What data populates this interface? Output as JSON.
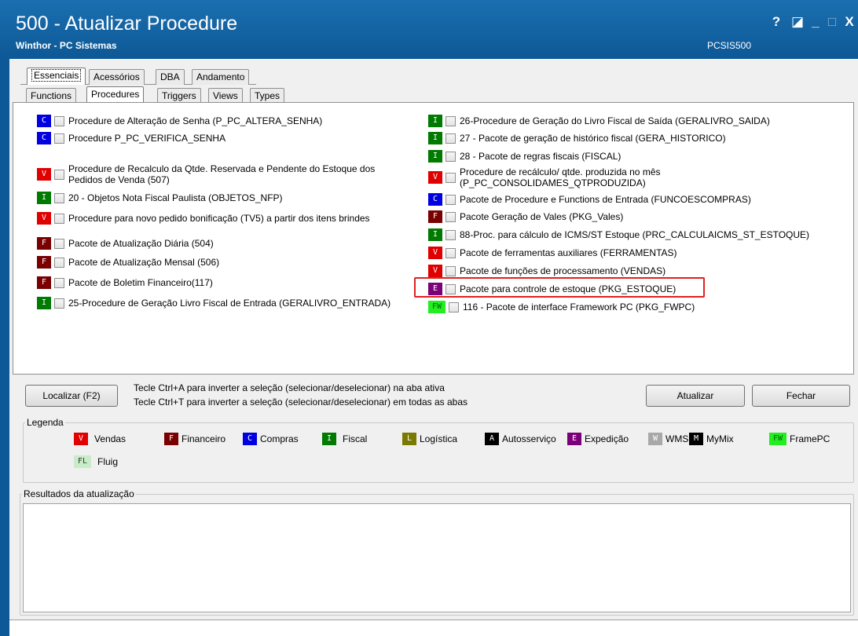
{
  "window": {
    "title": "500 - Atualizar Procedure",
    "subtitle": "Winthor - PC Sistemas",
    "code": "PCSIS500",
    "controls": {
      "help": "?",
      "restore": "◪",
      "minimize": "_",
      "maximize": "□",
      "close": "X"
    }
  },
  "top_tabs": [
    "Essenciais",
    "Acessórios",
    "DBA",
    "Andamento"
  ],
  "sub_tabs": [
    "Functions",
    "Procedures",
    "Triggers",
    "Views",
    "Types"
  ],
  "tag_colors": {
    "V": "#e00000",
    "F": "#7a0000",
    "C": "#0000e0",
    "I": "#007a00",
    "L": "#7a7a00",
    "A": "#000000",
    "E": "#7a007a",
    "W": "#a8a8a8",
    "M": "#000000",
    "FW": "#22ee22",
    "FL": "#c8ecc8"
  },
  "left_items": [
    {
      "tag": "C",
      "label": "Procedure de Alteração de Senha (P_PC_ALTERA_SENHA)"
    },
    {
      "tag": "C",
      "label": "Procedure P_PC_VERIFICA_SENHA"
    },
    {
      "tag": "V",
      "label": "Procedure de Recalculo da Qtde. Reservada e Pendente do Estoque dos",
      "label2": "Pedidos de Venda (507)"
    },
    {
      "tag": "I",
      "label": "20 - Objetos Nota Fiscal Paulista (OBJETOS_NFP)"
    },
    {
      "tag": "V",
      "label": "Procedure para novo pedido bonificação (TV5) a partir dos itens brindes"
    },
    {
      "tag": "F",
      "label": "Pacote de Atualização Diária (504)"
    },
    {
      "tag": "F",
      "label": "Pacote de Atualização Mensal (506)"
    },
    {
      "tag": "F",
      "label": "Pacote de Boletim Financeiro(117)"
    },
    {
      "tag": "I",
      "label": "25-Procedure de Geração Livro Fiscal de Entrada (GERALIVRO_ENTRADA)"
    }
  ],
  "right_items": [
    {
      "tag": "I",
      "label": "26-Procedure de Geração do Livro Fiscal de Saída (GERALIVRO_SAIDA)"
    },
    {
      "tag": "I",
      "label": "27 - Pacote de geração de histórico fiscal (GERA_HISTORICO)"
    },
    {
      "tag": "I",
      "label": "28 - Pacote de regras fiscais (FISCAL)"
    },
    {
      "tag": "V",
      "label": "Procedure de recálculo/ qtde. produzida no mês",
      "label2": "(P_PC_CONSOLIDAMES_QTPRODUZIDA)"
    },
    {
      "tag": "C",
      "label": "Pacote de Procedure e Functions de Entrada (FUNCOESCOMPRAS)"
    },
    {
      "tag": "F",
      "label": "Pacote Geração de Vales (PKG_Vales)"
    },
    {
      "tag": "I",
      "label": "88-Proc. para cálculo de ICMS/ST Estoque (PRC_CALCULAICMS_ST_ESTOQUE)"
    },
    {
      "tag": "V",
      "label": "Pacote de ferramentas auxiliares (FERRAMENTAS)"
    },
    {
      "tag": "V",
      "label": "Pacote de funções de processamento (VENDAS)"
    },
    {
      "tag": "E",
      "label": "Pacote para controle de estoque (PKG_ESTOQUE)"
    },
    {
      "tag": "FW",
      "label": "116 - Pacote de interface Framework PC (PKG_FWPC)"
    }
  ],
  "buttons": {
    "localizar": "Localizar (F2)",
    "atualizar": "Atualizar",
    "fechar": "Fechar"
  },
  "hints": [
    "Tecle Ctrl+A para inverter a seleção (selecionar/deselecionar) na aba ativa",
    "Tecle Ctrl+T para inverter a seleção (selecionar/deselecionar) em todas as abas"
  ],
  "legend": {
    "title": "Legenda",
    "entries": [
      {
        "tag": "V",
        "label": "Vendas"
      },
      {
        "tag": "F",
        "label": "Financeiro"
      },
      {
        "tag": "C",
        "label": "Compras"
      },
      {
        "tag": "I",
        "label": "Fiscal"
      },
      {
        "tag": "L",
        "label": "Logística"
      },
      {
        "tag": "A",
        "label": "Autosserviço"
      },
      {
        "tag": "E",
        "label": "Expedição"
      },
      {
        "tag": "W",
        "label": "WMS"
      },
      {
        "tag": "M",
        "label": "MyMix"
      },
      {
        "tag": "FW",
        "label": "FramePC"
      },
      {
        "tag": "FL",
        "label": "Fluig"
      }
    ]
  },
  "results": {
    "title": "Resultados da atualização"
  }
}
